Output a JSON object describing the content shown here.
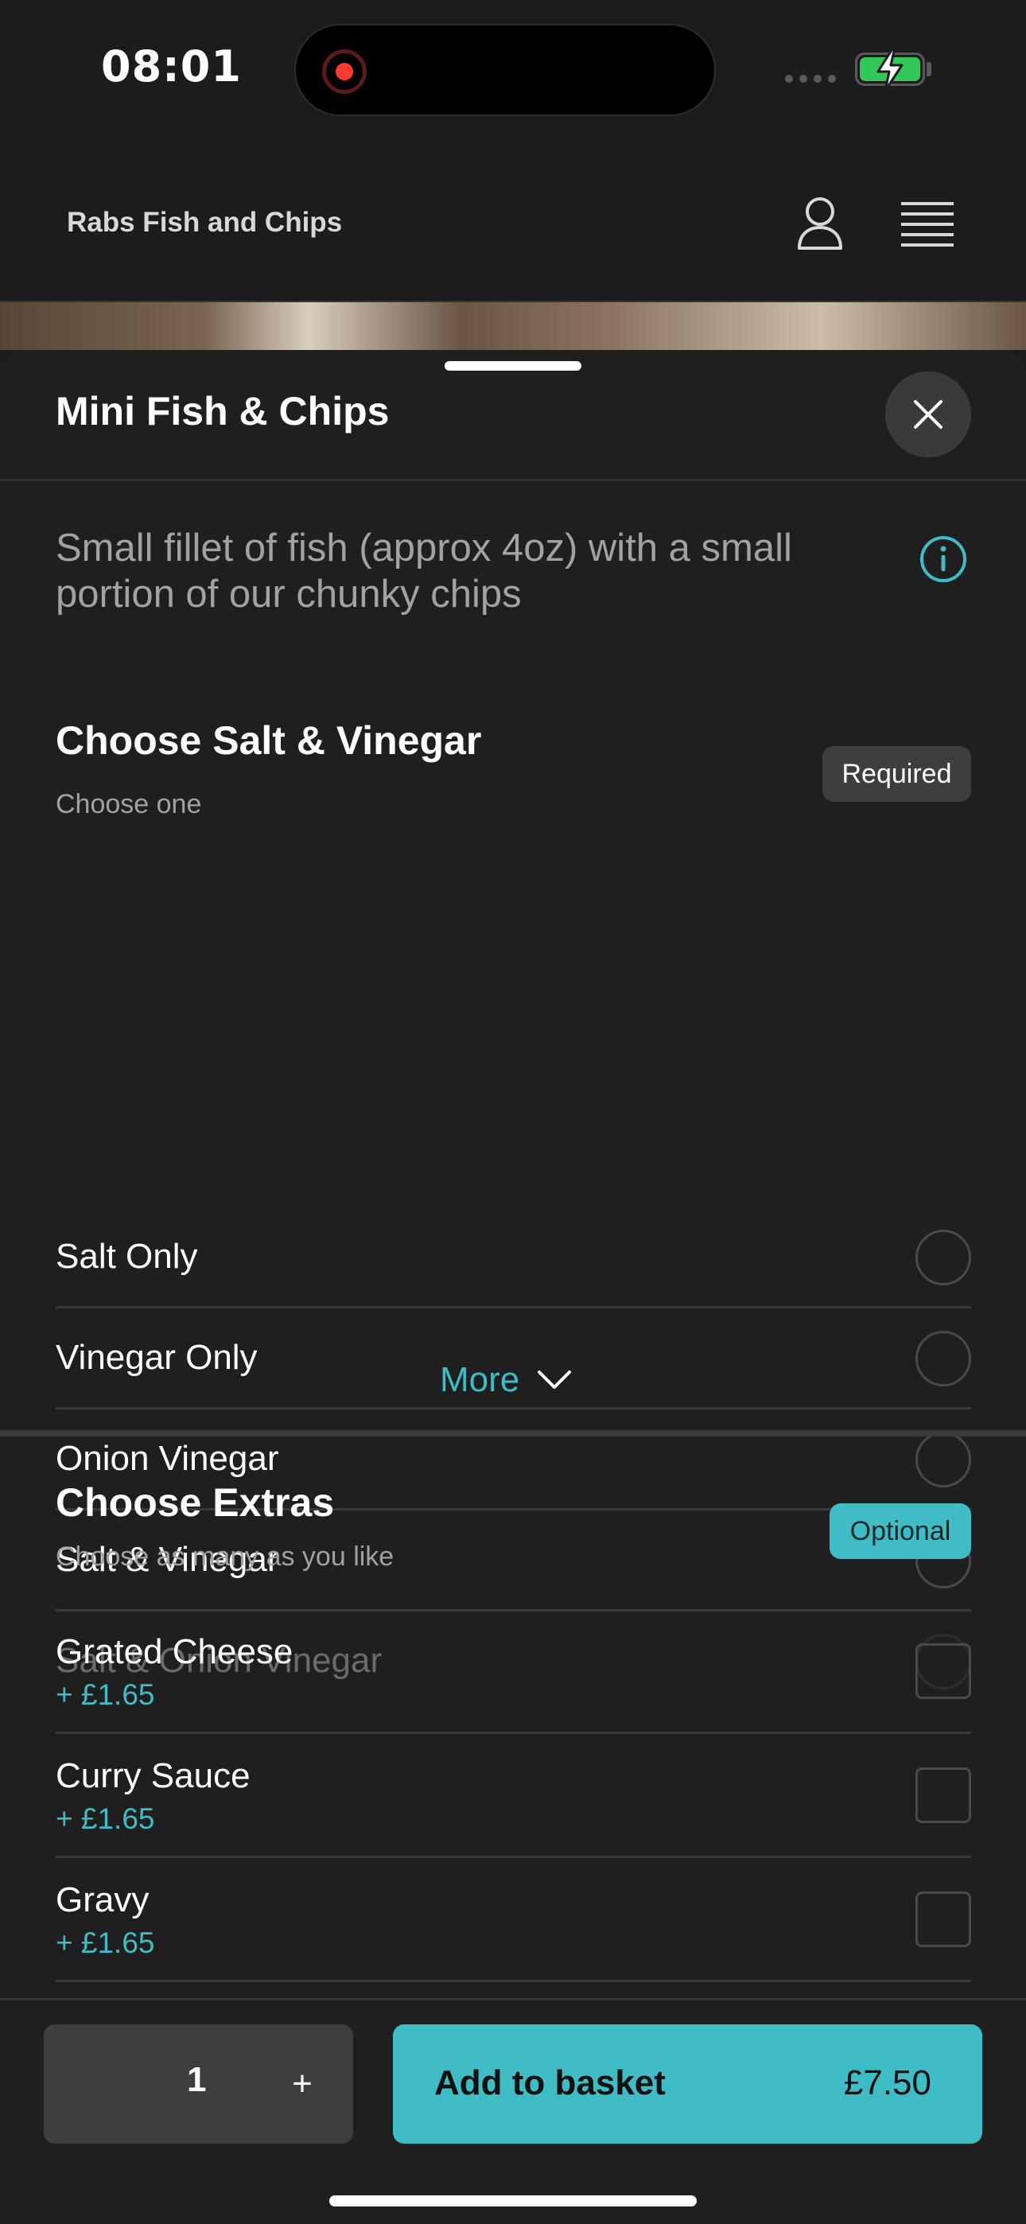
{
  "status_bar": {
    "time": "08:01",
    "icons": [
      "screen-record-icon",
      "signal-icon",
      "battery-charging-icon"
    ],
    "battery_level": 1.0,
    "colors": {
      "battery": "#34c759",
      "record": "#ff3b30"
    }
  },
  "header": {
    "site_title": "Rabs Fish and Chips",
    "icons": [
      "user-icon",
      "menu-icon"
    ]
  },
  "item": {
    "title": "Mini Fish & Chips",
    "description": "Small fillet of fish (approx 4oz) with a small portion of our chunky chips"
  },
  "salt_section": {
    "title": "Choose Salt & Vinegar",
    "subtitle": "Choose one",
    "badge": "Required",
    "options": [
      {
        "label": "Salt Only"
      },
      {
        "label": "Vinegar Only"
      },
      {
        "label": "Onion Vinegar"
      },
      {
        "label": "Salt & Vinegar"
      },
      {
        "label": "Salt & Onion Vinegar"
      }
    ],
    "more_label": "More"
  },
  "extras_section": {
    "title": "Choose Extras",
    "subtitle": "Choose as many as you like",
    "badge": "Optional",
    "items": [
      {
        "label": "Grated Cheese",
        "price": "+ £1.65"
      },
      {
        "label": "Curry Sauce",
        "price": "+ £1.65"
      },
      {
        "label": "Gravy",
        "price": "+ £1.65"
      }
    ]
  },
  "footer": {
    "quantity": "1",
    "plus_label": "+",
    "add_label": "Add to basket",
    "total": "£7.50"
  },
  "colors": {
    "accent": "#3fbcc5",
    "background": "#1f1f1f",
    "divider": "#3a3a3c"
  }
}
